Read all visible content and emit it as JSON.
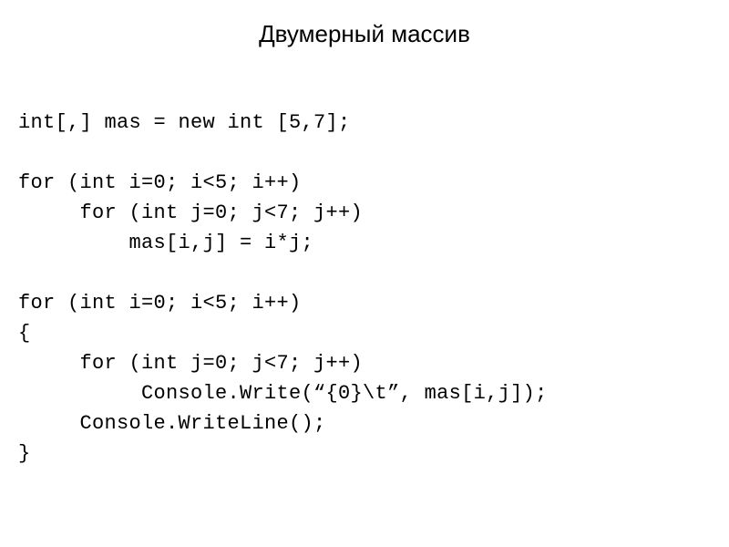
{
  "title": "Двумерный массив",
  "code": {
    "line1": "int[,] mas = new int [5,7];",
    "line2": "",
    "line3": "for (int i=0; i<5; i++)",
    "line4": "     for (int j=0; j<7; j++)",
    "line5": "         mas[i,j] = i*j;",
    "line6": "",
    "line7": "for (int i=0; i<5; i++)",
    "line8": "{",
    "line9": "     for (int j=0; j<7; j++)",
    "line10": "          Console.Write(“{0}\\t”, mas[i,j]);",
    "line11": "     Console.WriteLine();",
    "line12": "}"
  }
}
